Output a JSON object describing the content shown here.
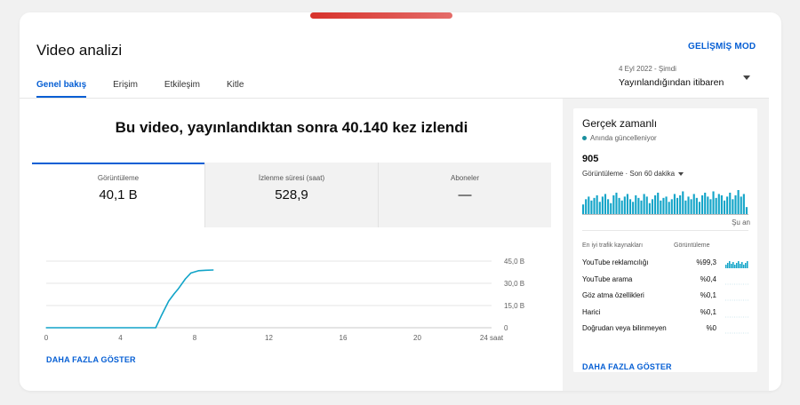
{
  "page": {
    "title": "Video analizi",
    "advanced_mode": "GELİŞMİŞ MOD"
  },
  "tabs": [
    {
      "label": "Genel bakış",
      "active": true
    },
    {
      "label": "Erişim",
      "active": false
    },
    {
      "label": "Etkileşim",
      "active": false
    },
    {
      "label": "Kitle",
      "active": false
    }
  ],
  "date_range": {
    "range": "4 Eyl 2022 - Şimdi",
    "label": "Yayınlandığından itibaren"
  },
  "headline": "Bu video, yayınlandıktan sonra 40.140 kez izlendi",
  "metrics": [
    {
      "label": "Görüntüleme",
      "value": "40,1 B",
      "active": true
    },
    {
      "label": "İzlenme süresi (saat)",
      "value": "528,9",
      "active": false
    },
    {
      "label": "Aboneler",
      "value": "—",
      "active": false
    }
  ],
  "chart_data": {
    "type": "line",
    "xlabel": "",
    "ylabel": "",
    "x_ticks": [
      "0",
      "4",
      "8",
      "12",
      "16",
      "20",
      "24 saat"
    ],
    "y_ticks": [
      "0",
      "15,0 B",
      "30,0 B",
      "45,0 B"
    ],
    "xlim": [
      0,
      24
    ],
    "ylim": [
      0,
      45000
    ],
    "series": [
      {
        "color": "#12a4c8",
        "x": [
          0,
          5.9,
          6.2,
          6.6,
          6.9,
          7.1,
          7.5,
          7.8,
          8.2,
          8.6,
          9.0
        ],
        "y": [
          0,
          0,
          8000,
          18000,
          23000,
          26000,
          33000,
          37000,
          38500,
          38800,
          39000
        ]
      }
    ]
  },
  "show_more": "DAHA FAZLA GÖSTER",
  "realtime": {
    "title": "Gerçek zamanlı",
    "subtitle": "Anında güncelleniyor",
    "count": "905",
    "metric_label": "Görüntüleme · Son 60 dakika",
    "now_label": "Şu an",
    "bar_values": [
      8,
      12,
      14,
      11,
      13,
      15,
      10,
      14,
      16,
      12,
      9,
      15,
      17,
      13,
      11,
      14,
      16,
      12,
      10,
      15,
      13,
      11,
      16,
      14,
      9,
      12,
      15,
      17,
      11,
      13,
      14,
      10,
      12,
      16,
      13,
      15,
      18,
      11,
      14,
      12,
      16,
      13,
      10,
      15,
      17,
      14,
      12,
      18,
      13,
      16,
      15,
      11,
      14,
      17,
      12,
      15,
      19,
      14,
      16,
      6
    ],
    "sources_header": {
      "name": "En iyi trafik kaynakları",
      "value": "Görüntüleme"
    },
    "sources": [
      {
        "name": "YouTube reklamcılığı",
        "value": "%99,3"
      },
      {
        "name": "YouTube arama",
        "value": "%0,4"
      },
      {
        "name": "Göz atma özellikleri",
        "value": "%0,1"
      },
      {
        "name": "Harici",
        "value": "%0,1"
      },
      {
        "name": "Doğrudan veya bilinmeyen",
        "value": "%0"
      }
    ],
    "show_more": "DAHA FAZLA GÖSTER"
  },
  "colors": {
    "accent": "#065fd4",
    "chart": "#12a4c8",
    "drag_bar": "#d7322b"
  }
}
